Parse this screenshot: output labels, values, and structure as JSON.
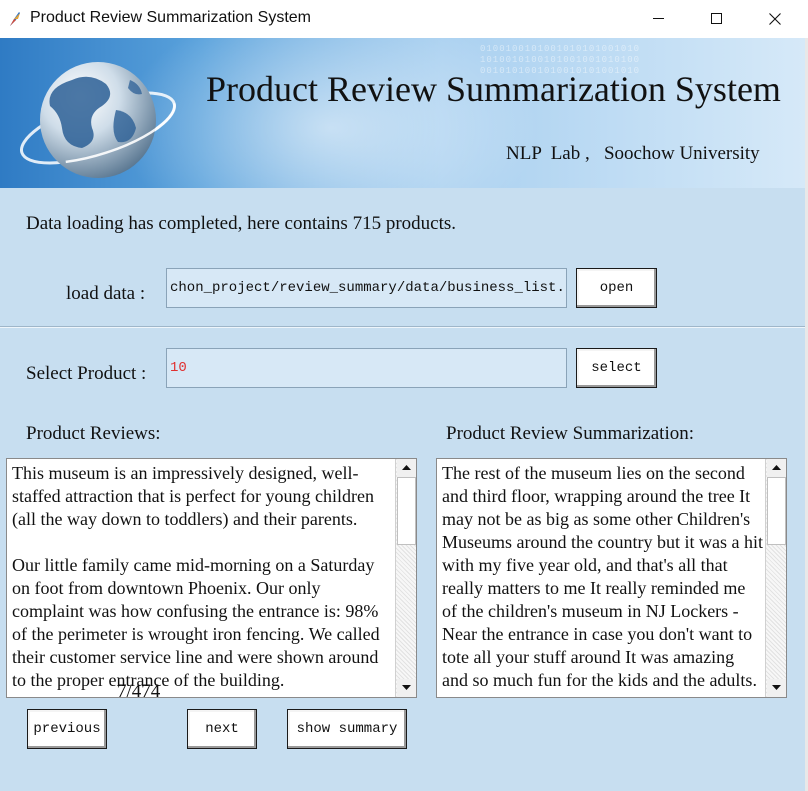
{
  "window": {
    "title": "Product Review Summarization System"
  },
  "banner": {
    "title": "Product Review Summarization System",
    "subtitle": "NLP  Lab ,   Soochow University"
  },
  "status": {
    "message": "Data loading has completed, here contains 715 products."
  },
  "load": {
    "label": "load data :",
    "path_value": "chon_project/review_summary/data/business_list.pkl",
    "open_label": "open"
  },
  "select": {
    "label": "Select Product :",
    "product_value": "10",
    "product_value_color": "#e03030",
    "select_label": "select"
  },
  "reviews": {
    "heading": "Product Reviews:",
    "text": "This museum is an impressively designed, well-staffed attraction that is perfect for young children (all the way down to toddlers) and their parents.\n\nOur little family came mid-morning on a Saturday on foot from downtown Phoenix. Our only complaint was how confusing the entrance is: 98% of the perimeter is wrought iron fencing. We called their customer service line and were shown around to the proper entrance of the building."
  },
  "summary": {
    "heading": "Product Review Summarization:",
    "text": "The rest of the museum lies on the second and third floor, wrapping around the tree It may not be as big as some other Children's Museums around the country but it was a hit with my five year old, and that's all that really matters to me It really reminded me of the children's museum in NJ Lockers - Near the entrance in case you don't want to tote all your stuff around It was amazing and so much fun for the kids and the adults."
  },
  "navigation": {
    "previous_label": "previous",
    "page_indicator": "7/474",
    "next_label": "next",
    "show_summary_label": "show summary"
  },
  "icons": {
    "app": "feather-icon",
    "minimize": "minimize-icon",
    "maximize": "maximize-icon",
    "close": "close-icon",
    "banner_image": "globe-icon"
  },
  "colors": {
    "client_background": "#c7def0",
    "field_background": "#d7e8f6",
    "banner_accent": "#2f7bc4"
  }
}
